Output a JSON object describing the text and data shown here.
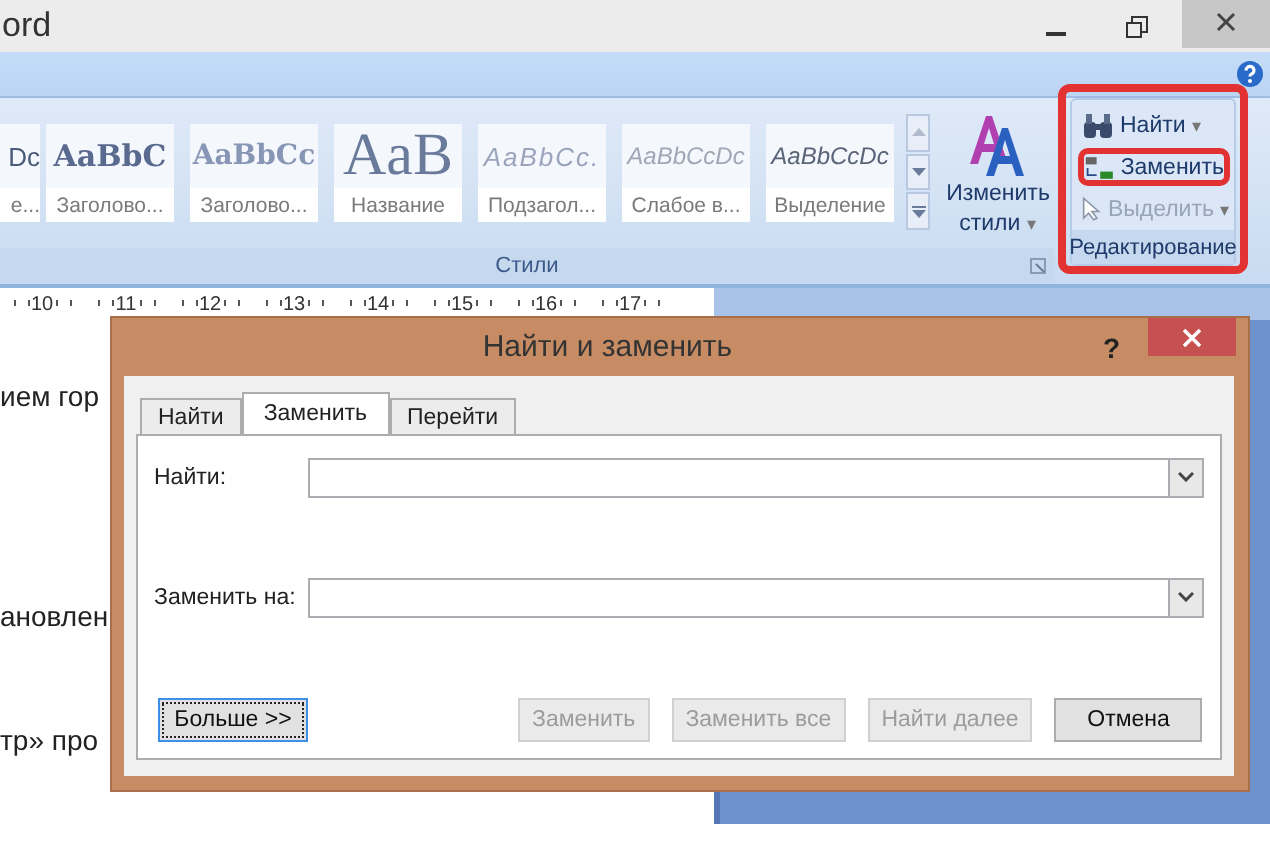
{
  "window": {
    "title": "ord"
  },
  "styles_group": {
    "label": "Стили",
    "gallery": [
      {
        "kind": "normal",
        "sample": "Dc",
        "label": "е..."
      },
      {
        "kind": "heading1",
        "sample": "AaBbC",
        "label": "Заголово..."
      },
      {
        "kind": "heading2",
        "sample": "AaBbCc",
        "label": "Заголово..."
      },
      {
        "kind": "title",
        "sample": "AaB",
        "label": "Название"
      },
      {
        "kind": "subtitle",
        "sample": "AaBbCc.",
        "label": "Подзагол..."
      },
      {
        "kind": "subtle",
        "sample": "AaBbCcDc",
        "label": "Слабое в..."
      },
      {
        "kind": "emphasis",
        "sample": "AaBbCcDc",
        "label": "Выделение"
      }
    ],
    "change_styles": {
      "label": "Изменить стили",
      "caret": "▾"
    }
  },
  "editing_group": {
    "label": "Редактирование",
    "highlighted": true,
    "items": [
      {
        "kind": "find",
        "label": "Найти",
        "disabled": false,
        "highlighted": false,
        "caret": "▾"
      },
      {
        "kind": "replace",
        "label": "Заменить",
        "disabled": false,
        "highlighted": true
      },
      {
        "kind": "select",
        "label": "Выделить",
        "disabled": true,
        "highlighted": false,
        "caret": "▾"
      }
    ]
  },
  "ruler": {
    "numbers": [
      "10",
      "11",
      "12",
      "13",
      "14",
      "15",
      "16",
      "17"
    ]
  },
  "document": {
    "lines": [
      "ием гор",
      "ановлен",
      "тр» про"
    ]
  },
  "dialog": {
    "title": "Найти и заменить",
    "help": "?",
    "tabs": [
      {
        "label": "Найти",
        "selected": false
      },
      {
        "label": "Заменить",
        "selected": true
      },
      {
        "label": "Перейти",
        "selected": false
      }
    ],
    "fields": [
      {
        "label": "Найти:"
      },
      {
        "label": "Заменить на:"
      }
    ],
    "buttons": [
      {
        "label": "Больше >>",
        "disabled": false,
        "focused": true
      },
      {
        "label": "Заменить",
        "disabled": true,
        "focused": false
      },
      {
        "label": "Заменить все",
        "disabled": true,
        "focused": false
      },
      {
        "label": "Найти далее",
        "disabled": true,
        "focused": false
      },
      {
        "label": "Отмена",
        "disabled": false,
        "focused": false
      }
    ]
  }
}
